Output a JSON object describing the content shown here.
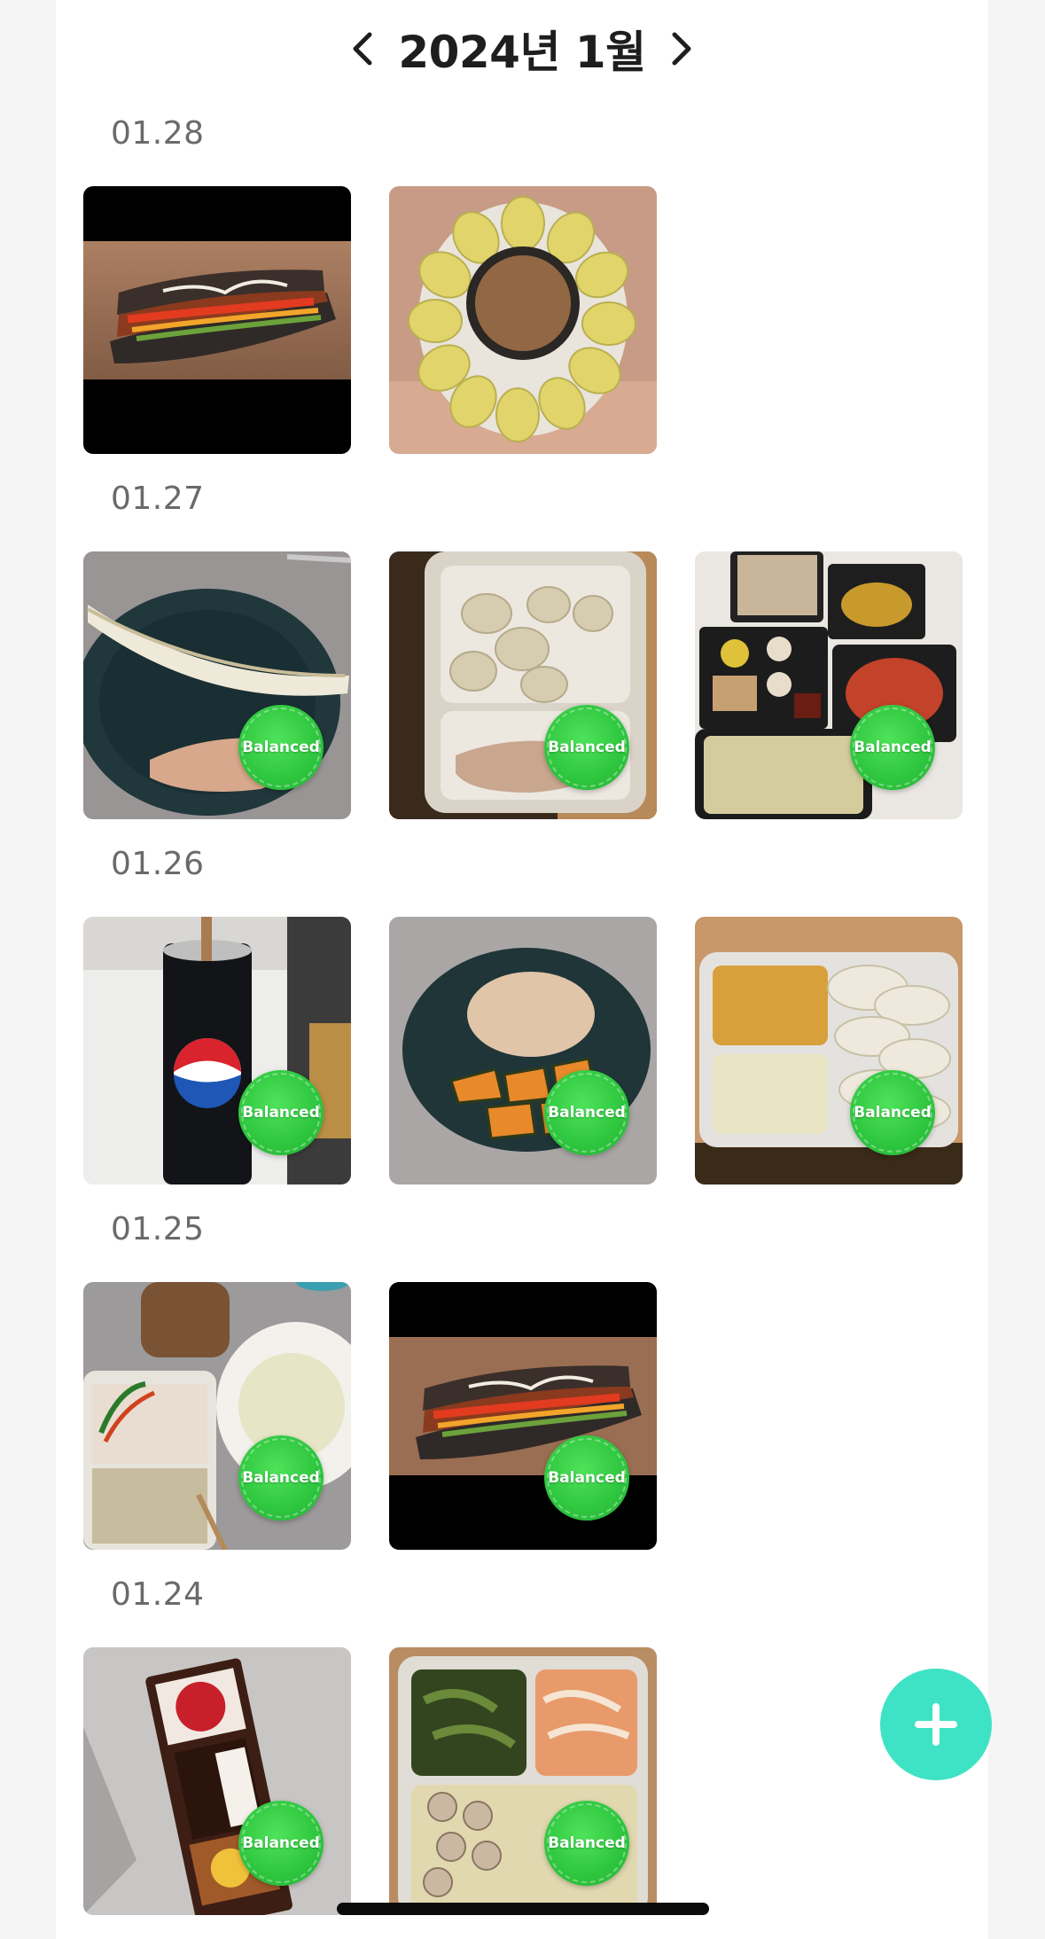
{
  "header": {
    "month_title": "2024년 1월",
    "prev_icon": "chevron-left-icon",
    "next_icon": "chevron-right-icon"
  },
  "groups": [
    {
      "date": "01.28",
      "meals": [
        {
          "photo": "grilled sandwich",
          "badge": ""
        },
        {
          "photo": "cabbage rolls with dipping sauce",
          "badge": ""
        }
      ]
    },
    {
      "date": "01.27",
      "meals": [
        {
          "photo": "banana and chicken breast",
          "badge": "Balanced"
        },
        {
          "photo": "rice cakes and chicken box",
          "badge": "Balanced"
        },
        {
          "photo": "takeout trays",
          "badge": "Balanced"
        }
      ]
    },
    {
      "date": "01.26",
      "meals": [
        {
          "photo": "pepsi can",
          "badge": "Balanced"
        },
        {
          "photo": "chicken and pumpkin",
          "badge": "Balanced"
        },
        {
          "photo": "pumpkin and cabbage box",
          "badge": "Balanced"
        }
      ]
    },
    {
      "date": "01.25",
      "meals": [
        {
          "photo": "salad and cabbage",
          "badge": "Balanced"
        },
        {
          "photo": "grilled sandwich",
          "badge": "Balanced"
        }
      ]
    },
    {
      "date": "01.24",
      "meals": [
        {
          "photo": "protein bar",
          "badge": "Balanced"
        },
        {
          "photo": "mushroom and vegetable box",
          "badge": "Balanced"
        }
      ]
    }
  ],
  "fab": {
    "icon": "plus-icon"
  },
  "colors": {
    "accent": "#3de3c4",
    "badge_green": "#2ec53e",
    "text_primary": "#1e1e1e",
    "text_secondary": "#6a6a6a"
  }
}
